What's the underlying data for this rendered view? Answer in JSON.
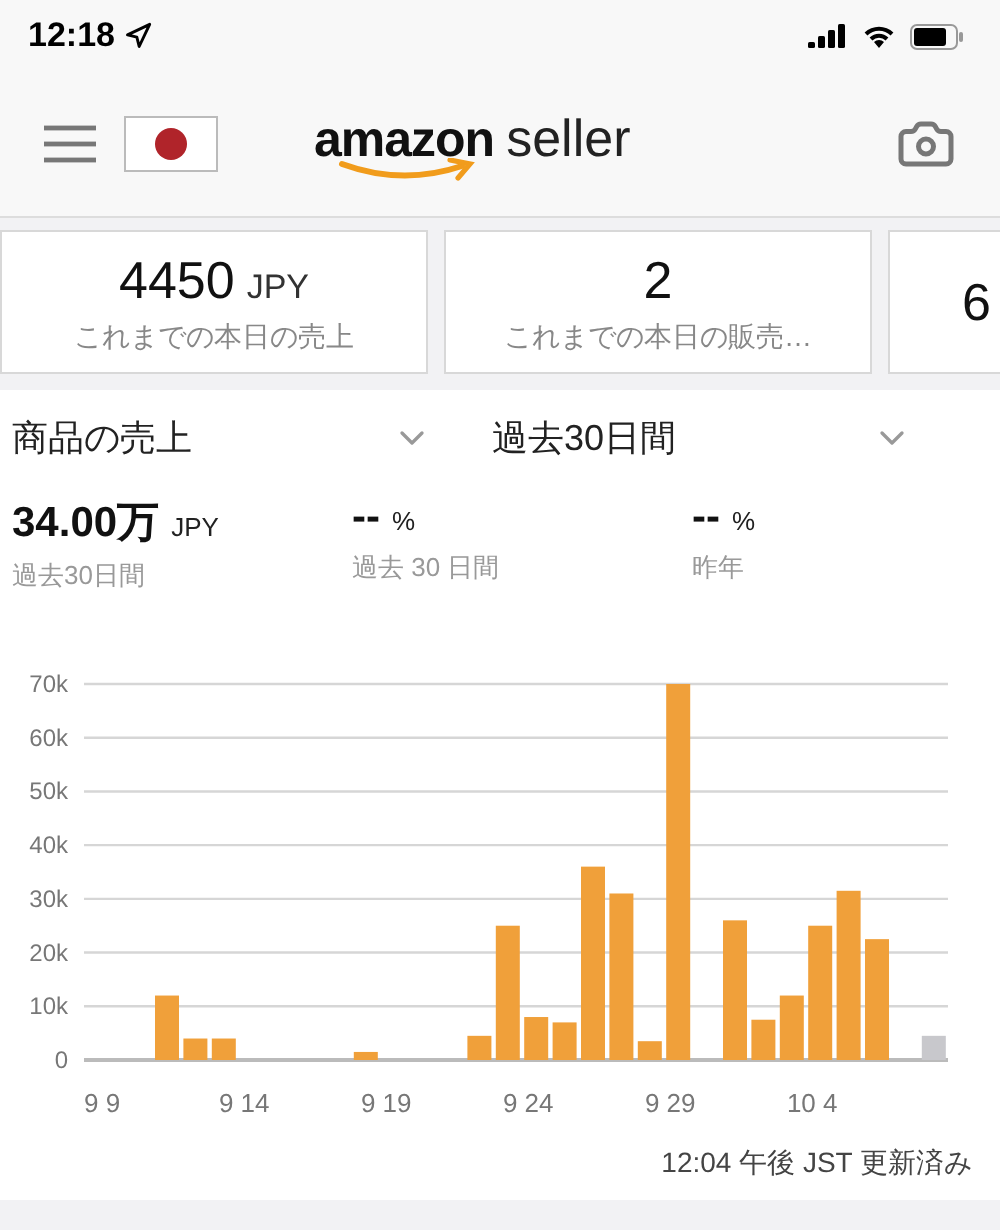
{
  "status_bar": {
    "time": "12:18"
  },
  "header": {
    "logo": {
      "brand": "amazon",
      "product": "seller"
    }
  },
  "cards": [
    {
      "value": "4450",
      "unit": "JPY",
      "label": "これまでの本日の売上"
    },
    {
      "value": "2",
      "label": "これまでの本日の販売…"
    },
    {
      "value": "6"
    }
  ],
  "filters": [
    {
      "label": "商品の売上"
    },
    {
      "label": "過去30日間"
    }
  ],
  "stats": [
    {
      "value": "34.00万",
      "unit": "JPY",
      "caption": "過去30日間"
    },
    {
      "value": "--",
      "unit": "%",
      "caption": "過去 30 日間"
    },
    {
      "value": "--",
      "unit": "%",
      "caption": "昨年"
    }
  ],
  "chart_data": {
    "type": "bar",
    "grid": true,
    "categories": [
      "9 9",
      null,
      null,
      null,
      null,
      "9 14",
      null,
      null,
      null,
      null,
      "9 19",
      null,
      null,
      null,
      null,
      "9 24",
      null,
      null,
      null,
      null,
      "9 29",
      null,
      null,
      null,
      null,
      "10 4",
      null,
      null,
      null,
      null
    ],
    "yticks": [
      {
        "value": 0,
        "label": "0"
      },
      {
        "value": 10000,
        "label": "10k"
      },
      {
        "value": 20000,
        "label": "20k"
      },
      {
        "value": 30000,
        "label": "30k"
      },
      {
        "value": 40000,
        "label": "40k"
      },
      {
        "value": 50000,
        "label": "50k"
      },
      {
        "value": 60000,
        "label": "60k"
      },
      {
        "value": 70000,
        "label": "70k"
      }
    ],
    "ylim": [
      0,
      70000
    ],
    "series": [
      {
        "color": "#f0a03a",
        "values": [
          0,
          0,
          12000,
          4000,
          4000,
          0,
          0,
          0,
          0,
          1500,
          0,
          0,
          0,
          4500,
          25000,
          8000,
          7000,
          36000,
          31000,
          3500,
          70000,
          0,
          26000,
          7500,
          12000,
          25000,
          31500,
          22500,
          0,
          null
        ]
      },
      {
        "color": "#c8c8cc",
        "values": [
          null,
          null,
          null,
          null,
          null,
          null,
          null,
          null,
          null,
          null,
          null,
          null,
          null,
          null,
          null,
          null,
          null,
          null,
          null,
          null,
          null,
          null,
          null,
          null,
          null,
          null,
          null,
          null,
          null,
          4500
        ]
      }
    ]
  },
  "footer": {
    "updated": "12:04 午後 JST 更新済み"
  }
}
